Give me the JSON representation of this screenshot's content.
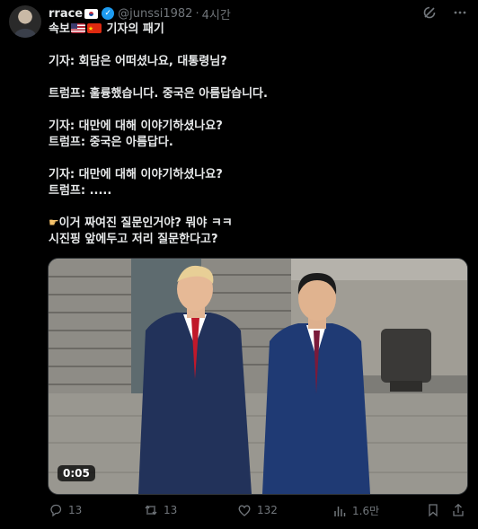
{
  "tweet": {
    "author_name": "rrace",
    "handle": "@junssi1982",
    "separator": "·",
    "time": "4시간",
    "lines": [
      "속보",
      "기자의 패기",
      "",
      "기자: 회담은 어떠셨나요, 대통령님?",
      "",
      "트럼프: 훌륭했습니다. 중국은 아름답습니다.",
      "",
      "기자: 대만에 대해 이야기하셨나요?",
      "트럼프: 중국은 아름답다.",
      "",
      "기자: 대만에 대해 이야기하셨나요?",
      "트럼프: .....",
      "",
      "이거 짜여진 질문인거야? 뭐야 ㅋㅋ",
      "시진핑 앞에두고 저리 질문한다고?"
    ]
  },
  "media": {
    "type": "video",
    "duration": "0:05"
  },
  "actions": {
    "replies": "13",
    "reposts": "13",
    "likes": "132",
    "views": "1.6만"
  },
  "icons": {
    "verified": "verified-badge-icon",
    "grok": "grok-icon",
    "more": "more-icon",
    "reply": "reply-icon",
    "repost": "repost-icon",
    "like": "like-icon",
    "views": "views-icon",
    "bookmark": "bookmark-icon",
    "share": "share-icon"
  },
  "colors": {
    "background": "#000000",
    "text": "#e7e9ea",
    "muted": "#71767b",
    "verified": "#1d9bf0"
  }
}
